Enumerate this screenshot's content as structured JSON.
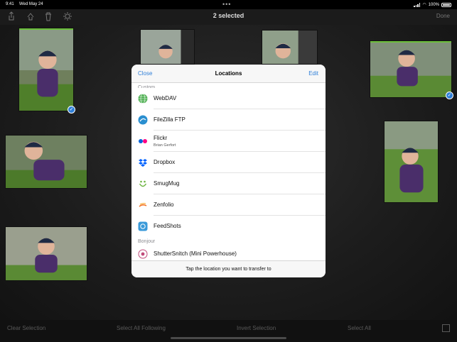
{
  "status_bar": {
    "time": "9:41",
    "date": "Wed May 24",
    "battery": "100%"
  },
  "toolbar": {
    "title": "2 selected",
    "done_label": "Done"
  },
  "bottom_bar": {
    "clear_selection": "Clear Selection",
    "select_all_following": "Select All Following",
    "invert_selection": "Invert Selection",
    "select_all": "Select All"
  },
  "locations_modal": {
    "close_label": "Close",
    "title": "Locations",
    "edit_label": "Edit",
    "custom_header": "Custom",
    "bonjour_header": "Bonjour",
    "custom_items": [
      {
        "label": "WebDAV",
        "icon": "webdav-globe-icon"
      },
      {
        "label": "FileZilla FTP",
        "icon": "filezilla-icon"
      },
      {
        "label": "Flickr",
        "sublabel": "Brian Gerfort",
        "icon": "flickr-icon"
      },
      {
        "label": "Dropbox",
        "icon": "dropbox-icon"
      },
      {
        "label": "SmugMug",
        "icon": "smugmug-icon"
      },
      {
        "label": "Zenfolio",
        "icon": "zenfolio-icon"
      },
      {
        "label": "FeedShots",
        "icon": "feedshots-icon"
      }
    ],
    "bonjour_items": [
      {
        "label": "ShutterSnitch (Mini Powerhouse)",
        "icon": "shuttersnitch-icon"
      }
    ],
    "footer_hint": "Tap the location you want to transfer to"
  },
  "photos": {
    "selected_count": 2
  },
  "colors": {
    "accent": "#2f7fd8",
    "selection_bar": "#6bbf3b",
    "background": "#1d1d1d"
  }
}
